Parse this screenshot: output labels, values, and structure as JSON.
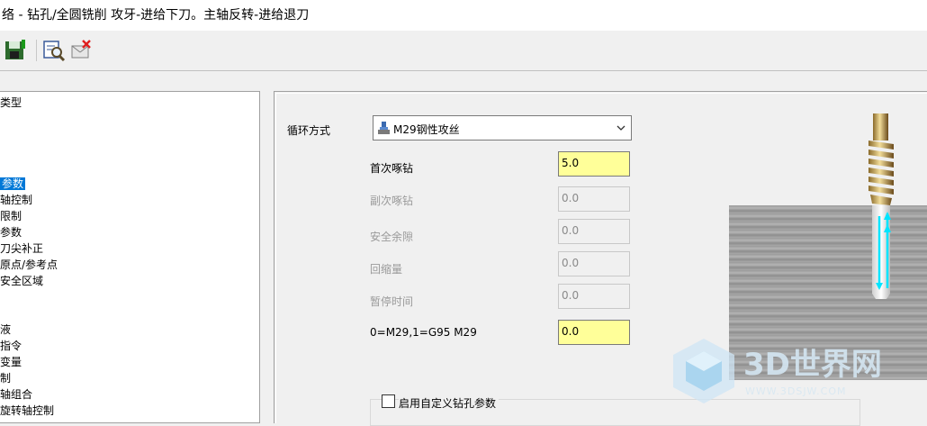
{
  "window": {
    "title": "络 - 钻孔/全圆铣削 攻牙-进给下刀。主轴反转-进给退刀"
  },
  "toolbar": {
    "buttons": [
      "save-icon",
      "zoom-preview-icon",
      "delete-icon"
    ]
  },
  "tree": {
    "items": [
      {
        "label": "类型",
        "selected": false
      },
      {
        "label": "",
        "selected": false
      },
      {
        "label": "",
        "selected": false
      },
      {
        "label": "",
        "selected": false
      },
      {
        "label": "参数",
        "selected": true
      },
      {
        "label": "轴控制",
        "selected": false
      },
      {
        "label": "限制",
        "selected": false
      },
      {
        "label": "参数",
        "selected": false
      },
      {
        "label": "刀尖补正",
        "selected": false
      },
      {
        "label": "原点/参考点",
        "selected": false
      },
      {
        "label": "安全区域",
        "selected": false
      },
      {
        "label": "",
        "selected": false
      },
      {
        "label": "",
        "selected": false
      },
      {
        "label": "液",
        "selected": false
      },
      {
        "label": "指令",
        "selected": false
      },
      {
        "label": "变量",
        "selected": false
      },
      {
        "label": "制",
        "selected": false
      },
      {
        "label": "轴组合",
        "selected": false
      },
      {
        "label": "旋转轴控制",
        "selected": false
      }
    ]
  },
  "params": {
    "cycle_label": "循环方式",
    "cycle_value": "M29钢性攻丝",
    "fields": [
      {
        "label": "首次啄钻",
        "value": "5.0",
        "enabled": true
      },
      {
        "label": "副次啄钻",
        "value": "0.0",
        "enabled": false
      },
      {
        "label": "安全余隙",
        "value": "0.0",
        "enabled": false
      },
      {
        "label": "回缩量",
        "value": "0.0",
        "enabled": false
      },
      {
        "label": "暂停时间",
        "value": "0.0",
        "enabled": false
      },
      {
        "label": "0=M29,1=G95 M29",
        "value": "0.0",
        "enabled": true
      }
    ],
    "custom_drill_label": "启用自定义钻孔参数"
  },
  "watermark": {
    "text": "3D世界网",
    "url_text": "WWW.3DSJW.COM"
  },
  "colors": {
    "highlight": "#ffff99",
    "selection": "#0078d7",
    "arrow": "#00e5ff"
  }
}
